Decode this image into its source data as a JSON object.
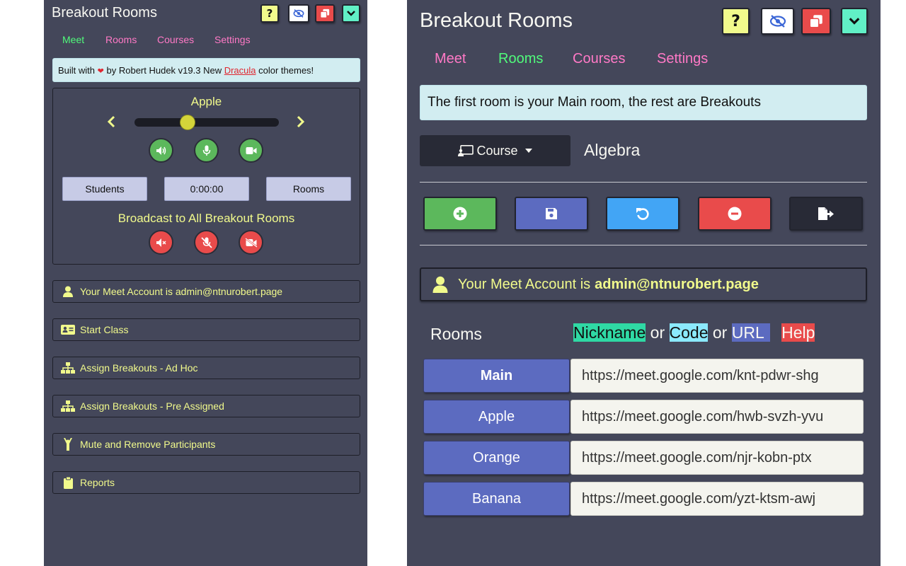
{
  "left": {
    "title": "Breakout Rooms",
    "nav": [
      "Meet",
      "Rooms",
      "Courses",
      "Settings"
    ],
    "alert": {
      "prefix": "Built with",
      "heart": "❤",
      "middle": "by Robert Hudek v19.3 New",
      "link": "Dracula",
      "suffix": "color themes!"
    },
    "room_name": "Apple",
    "slider_fraction": 0.35,
    "buttons": {
      "students": "Students",
      "timer": "0:00:00",
      "rooms": "Rooms"
    },
    "broadcast_label": "Broadcast to All Breakout Rooms",
    "menu": [
      {
        "icon": "user-icon",
        "label": "Your Meet Account is admin@ntnurobert.page"
      },
      {
        "icon": "id-card-icon",
        "label": "Start Class"
      },
      {
        "icon": "sitemap-icon",
        "label": "Assign Breakouts - Ad Hoc"
      },
      {
        "icon": "sitemap-icon",
        "label": "Assign Breakouts - Pre Assigned"
      },
      {
        "icon": "person-raise-icon",
        "label": "Mute and Remove Participants"
      },
      {
        "icon": "clipboard-icon",
        "label": "Reports"
      }
    ]
  },
  "right": {
    "title": "Breakout Rooms",
    "nav": [
      "Meet",
      "Rooms",
      "Courses",
      "Settings"
    ],
    "alert": "The first room is your Main room, the rest are Breakouts",
    "course_button": "Course",
    "course_name": "Algebra",
    "account": {
      "prefix": "Your Meet Account is",
      "email": "admin@ntnurobert.page"
    },
    "rooms_header": "Rooms",
    "legend": {
      "nickname": "Nickname",
      "or1": "or",
      "code": "Code",
      "or2": "or",
      "url": "URL",
      "help": "Help"
    },
    "rooms": [
      {
        "name": "Main",
        "url": "https://meet.google.com/knt-pdwr-shg"
      },
      {
        "name": "Apple",
        "url": "https://meet.google.com/hwb-svzh-yvu"
      },
      {
        "name": "Orange",
        "url": "https://meet.google.com/njr-kobn-ptx"
      },
      {
        "name": "Banana",
        "url": "https://meet.google.com/yzt-ktsm-awj"
      }
    ]
  },
  "colors": {
    "panel_bg": "#44475a",
    "yellow": "#f1fa8c",
    "pink": "#ff79c6",
    "green": "#50fa7b",
    "accent_green": "#5cb85c",
    "accent_red": "#e94b4b",
    "accent_blue": "#5c6bc0",
    "accent_sky": "#42a5f5",
    "cyan": "#8be9fd",
    "mint": "#61f0c6"
  }
}
